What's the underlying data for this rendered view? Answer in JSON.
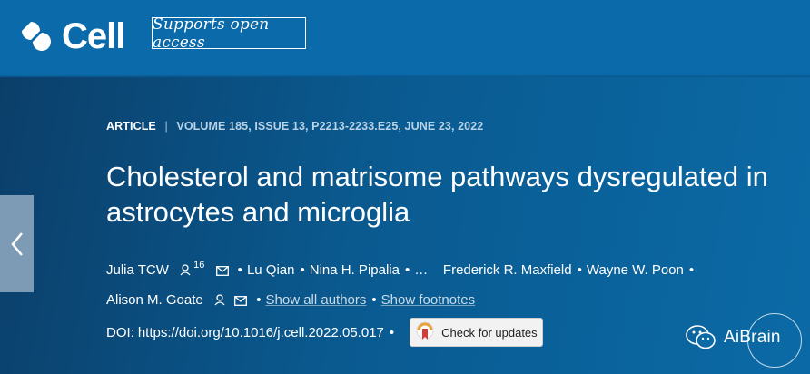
{
  "header": {
    "brand": "Cell",
    "badge": "Supports open access"
  },
  "article": {
    "type": "ARTICLE",
    "separator": "|",
    "volume_info": "VOLUME 185, ISSUE 13, P2213-2233.E25, JUNE 23, 2022",
    "title": "Cholesterol and matrisome pathways dysregulated in astrocytes and microglia",
    "authors": [
      {
        "name": "Julia TCW",
        "person_icon": true,
        "sup": "16",
        "email_icon": true
      },
      {
        "name": "Lu Qian"
      },
      {
        "name": "Nina H. Pipalia"
      },
      {
        "name": "…"
      },
      {
        "name": "Frederick R. Maxfield"
      },
      {
        "name": "Wayne W. Poon"
      },
      {
        "name": "Alison M. Goate",
        "person_icon": true,
        "email_icon": true
      }
    ],
    "bullet": "•",
    "show_all_authors": "Show all authors",
    "show_footnotes": "Show footnotes",
    "doi_label": "DOI:",
    "doi_link": "https://doi.org/10.1016/j.cell.2022.05.017",
    "check_updates": "Check for updates"
  },
  "watermark": {
    "text": "AiBrain"
  },
  "icons": {
    "prev": "chevron-left-icon",
    "person": "person-icon",
    "email": "envelope-icon",
    "crossmark": "crossmark-icon",
    "wechat": "wechat-icon"
  },
  "colors": {
    "header_bg": "#0a6aaa",
    "hero_bg": "#0a5a90",
    "nav_arrow_bg": "#7d9bb5"
  }
}
